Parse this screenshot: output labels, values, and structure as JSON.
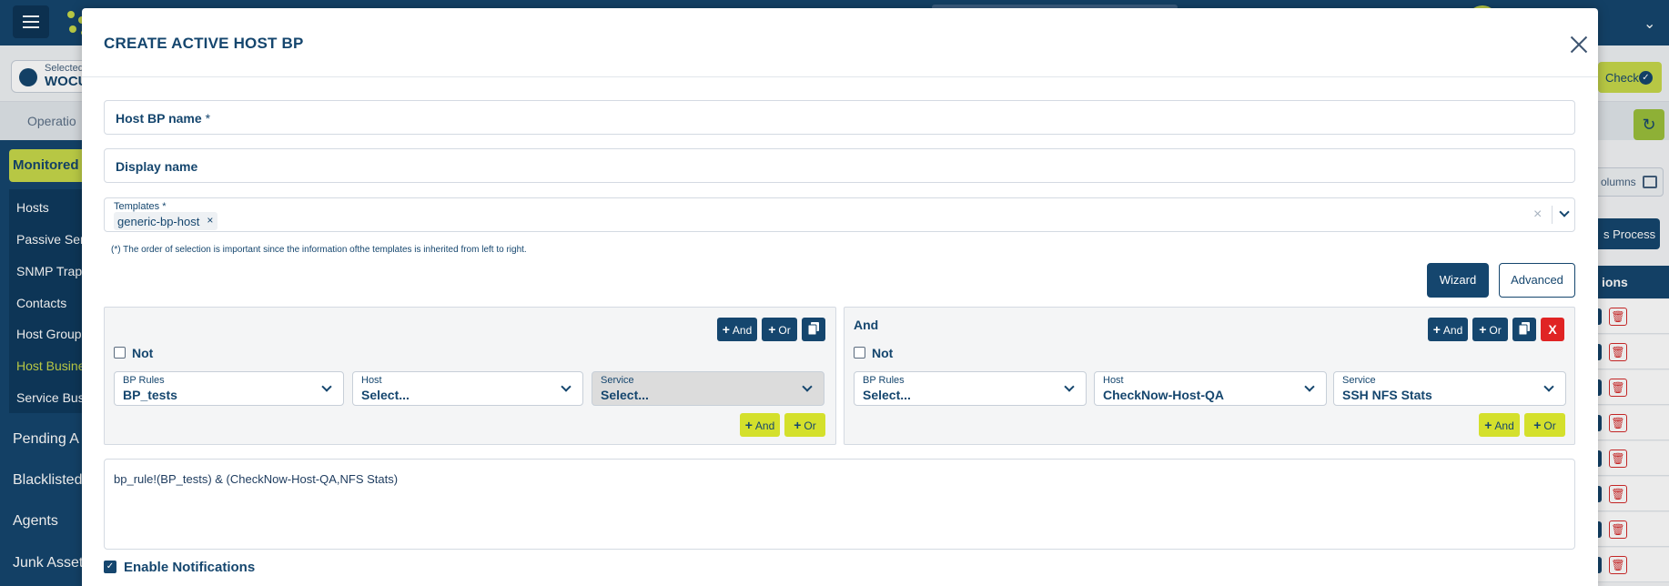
{
  "background": {
    "logo_text": "",
    "selected_label": "Selected",
    "selected_value": "WOCU",
    "check_label": "Check",
    "operations_label": "Operatio",
    "sidebar_monitored": "Monitored",
    "sidebar_items": [
      "Hosts",
      "Passive Serv",
      "SNMP Traps",
      "Contacts",
      "Host Group",
      "Host Busine",
      "Service Bus"
    ],
    "sidebar_main": [
      "Pending A",
      "Blacklisted",
      "Agents",
      "Junk Asset"
    ],
    "columns_label": "olumns",
    "process_label": "s Process",
    "actions_header": "ions"
  },
  "modal": {
    "title": "CREATE ACTIVE HOST BP",
    "host_bp_name_label": "Host BP name",
    "required_mark": "*",
    "display_name_label": "Display name",
    "templates": {
      "label": "Templates *",
      "chips": [
        "generic-bp-host"
      ],
      "chip_remove": "×",
      "clear": "×",
      "note": "(*) The order of selection is important since the information ofthe templates is inherited from left to right."
    },
    "wizard_label": "Wizard",
    "advanced_label": "Advanced",
    "panels": [
      {
        "title": "",
        "and_label": "And",
        "or_label": "Or",
        "not_label": "Not",
        "bp_rules": {
          "label": "BP Rules",
          "value": "BP_tests"
        },
        "host": {
          "label": "Host",
          "value": "Select..."
        },
        "service": {
          "label": "Service",
          "value": "Select..."
        },
        "add_and_label": "And",
        "add_or_label": "Or"
      },
      {
        "title": "And",
        "and_label": "And",
        "or_label": "Or",
        "delete_label": "X",
        "not_label": "Not",
        "bp_rules": {
          "label": "BP Rules",
          "value": "Select..."
        },
        "host": {
          "label": "Host",
          "value": "CheckNow-Host-QA"
        },
        "service": {
          "label": "Service",
          "value": "SSH NFS Stats"
        },
        "add_and_label": "And",
        "add_or_label": "Or"
      }
    ],
    "expression": "bp_rule!(BP_tests) & (CheckNow-Host-QA,NFS Stats)",
    "enable_notifications_label": "Enable Notifications",
    "enable_notifications_checked": true
  }
}
